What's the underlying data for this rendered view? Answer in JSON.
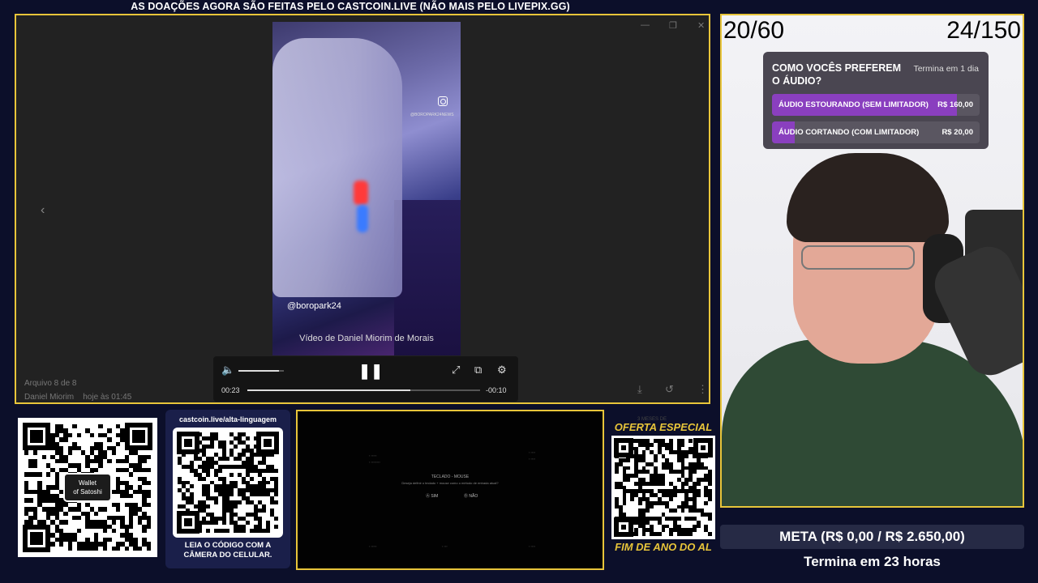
{
  "banner": "AS DOAÇÕES AGORA SÃO FEITAS PELO CASTCOIN.LIVE (NÃO MAIS PELO LIVEPIX.GG)",
  "viewer": {
    "video": {
      "handle_overlay": "@boropark24",
      "handle_small": "@BOROPARK24NEWS",
      "credit": "Vídeo de Daniel Miorim de Morais"
    },
    "file_position": "Arquivo 8 de 8",
    "file_author": "Daniel Miorim",
    "file_time": "hoje às 01:45",
    "controls": {
      "elapsed": "00:23",
      "remaining": "-00:10",
      "progress": 0.7,
      "volume": 0.9
    }
  },
  "qr_wallet": {
    "logo_line1": "Wallet",
    "logo_line2": "of Satoshi"
  },
  "qr_castcoin": {
    "url": "castcoin.live/alta-linguagem",
    "caption_line1": "LEIA O CÓDIGO COM A",
    "caption_line2": "CÂMERA DO CELULAR."
  },
  "game_dialog": {
    "title": "TECLADO - MOUSE",
    "text": "Deseja definir o teclado + mouse como o método de entrada atual?",
    "option_yes": "SIM",
    "option_no": "NÃO"
  },
  "offer": {
    "top_small": "3 MESES DE",
    "title": "OFERTA ESPECIAL",
    "bottom": "FIM DE ANO DO AL"
  },
  "cam": {
    "counter_left": "20/60",
    "counter_right": "24/150"
  },
  "poll": {
    "question": "COMO VOCÊS PREFEREM O ÁUDIO?",
    "ends": "Termina em 1 dia",
    "options": [
      {
        "label": "ÁUDIO ESTOURANDO (SEM LIMITADOR)",
        "amount": "R$ 160,00",
        "share": 0.89
      },
      {
        "label": "ÁUDIO CORTANDO (COM LIMITADOR)",
        "amount": "R$ 20,00",
        "share": 0.11
      }
    ]
  },
  "goal": {
    "text": "META (R$ 0,00 / R$ 2.650,00)",
    "ends": "Termina em 23 horas"
  }
}
